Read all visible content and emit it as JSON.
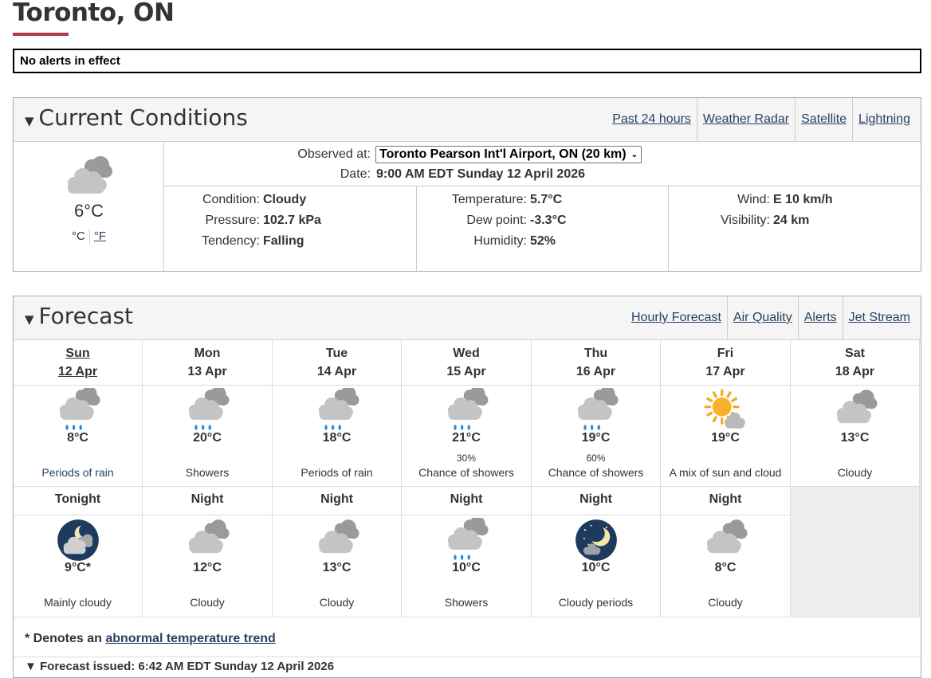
{
  "page": {
    "title": "Toronto, ON"
  },
  "alerts": {
    "text": "No alerts in effect"
  },
  "current": {
    "title": "Current Conditions",
    "links": [
      "Past 24 hours",
      "Weather Radar",
      "Satellite",
      "Lightning"
    ],
    "icon": "cloudy-icon",
    "temp": "6°C",
    "unit_c": "°C",
    "unit_f": "°F",
    "observed_label": "Observed at:",
    "observed_value": "Toronto Pearson Int'l Airport, ON (20 km)",
    "date_label": "Date:",
    "date_value": "9:00 AM EDT Sunday 12 April 2026",
    "col1": [
      {
        "k": "Condition:",
        "v": "Cloudy"
      },
      {
        "k": "Pressure:",
        "v": "102.7 kPa"
      },
      {
        "k": "Tendency:",
        "v": "Falling"
      }
    ],
    "col2": [
      {
        "k": "Temperature:",
        "v": "5.7°C"
      },
      {
        "k": "Dew point:",
        "v": "-3.3°C"
      },
      {
        "k": "Humidity:",
        "v": "52%"
      }
    ],
    "col3": [
      {
        "k": "Wind:",
        "v": "E 10 km/h"
      },
      {
        "k": "Visibility:",
        "v": "24 km"
      }
    ]
  },
  "forecast": {
    "title": "Forecast",
    "links": [
      "Hourly Forecast",
      "Air Quality",
      "Alerts",
      "Jet Stream"
    ],
    "days": [
      {
        "day": "Sun",
        "date": "12 Apr",
        "icon": "rain-icon",
        "temp": "8°C",
        "pop": "",
        "text": "Periods of rain",
        "today": true
      },
      {
        "day": "Mon",
        "date": "13 Apr",
        "icon": "rain-icon",
        "temp": "20°C",
        "pop": "",
        "text": "Showers"
      },
      {
        "day": "Tue",
        "date": "14 Apr",
        "icon": "rain-icon",
        "temp": "18°C",
        "pop": "",
        "text": "Periods of rain"
      },
      {
        "day": "Wed",
        "date": "15 Apr",
        "icon": "rain-icon",
        "temp": "21°C",
        "pop": "30%",
        "text": "Chance of showers"
      },
      {
        "day": "Thu",
        "date": "16 Apr",
        "icon": "rain-icon",
        "temp": "19°C",
        "pop": "60%",
        "text": "Chance of showers"
      },
      {
        "day": "Fri",
        "date": "17 Apr",
        "icon": "sun-cloud-icon",
        "temp": "19°C",
        "pop": "",
        "text": "A mix of sun and cloud"
      },
      {
        "day": "Sat",
        "date": "18 Apr",
        "icon": "cloudy-icon",
        "temp": "13°C",
        "pop": "",
        "text": "Cloudy"
      }
    ],
    "nights": [
      {
        "title": "Tonight",
        "icon": "night-cloudy-icon",
        "temp": "9°C*",
        "text": "Mainly cloudy"
      },
      {
        "title": "Night",
        "icon": "cloudy-icon",
        "temp": "12°C",
        "text": "Cloudy"
      },
      {
        "title": "Night",
        "icon": "cloudy-icon",
        "temp": "13°C",
        "text": "Cloudy"
      },
      {
        "title": "Night",
        "icon": "rain-icon",
        "temp": "10°C",
        "text": "Showers"
      },
      {
        "title": "Night",
        "icon": "night-partly-cloudy-icon",
        "temp": "10°C",
        "text": "Cloudy periods"
      },
      {
        "title": "Night",
        "icon": "cloudy-icon",
        "temp": "8°C",
        "text": "Cloudy"
      }
    ],
    "legend_prefix": "* Denotes an",
    "legend_link": "abnormal temperature trend",
    "issued": "▼ Forecast issued: 6:42 AM EDT Sunday 12 April 2026"
  }
}
